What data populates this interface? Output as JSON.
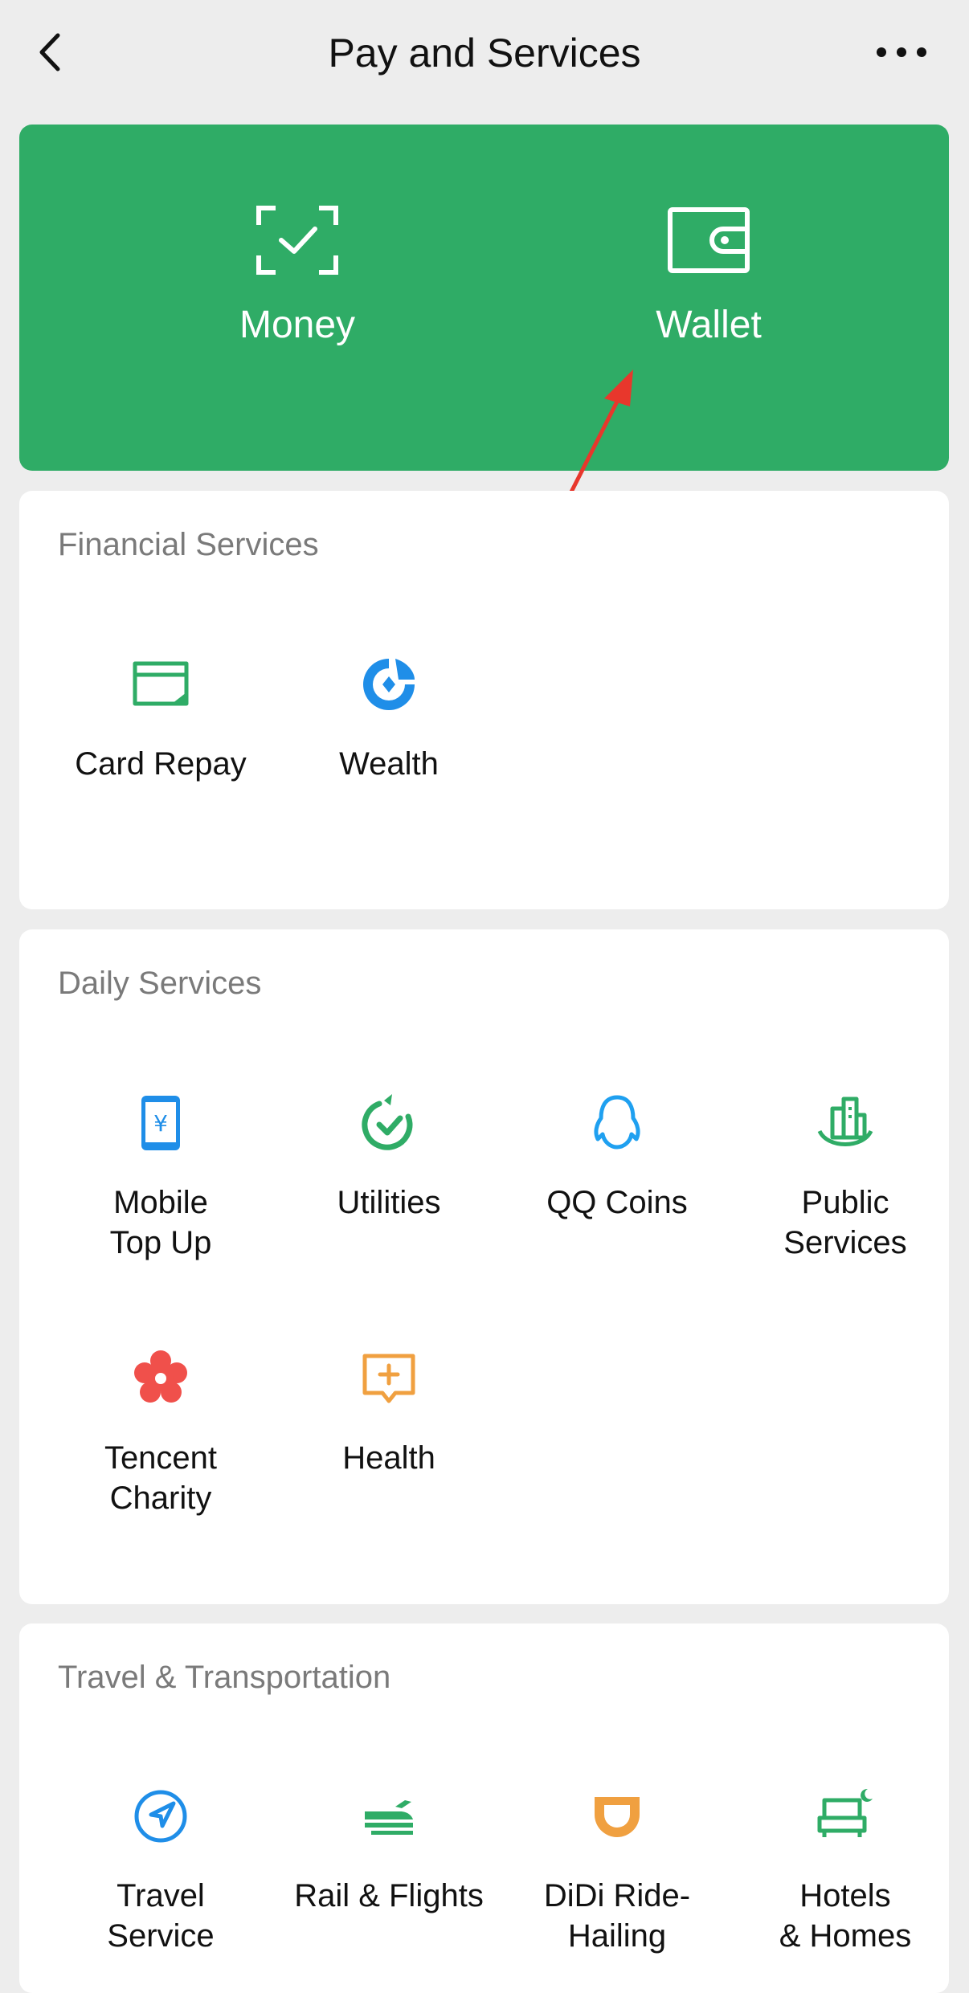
{
  "nav": {
    "title": "Pay and Services"
  },
  "hero": {
    "money_label": "Money",
    "wallet_label": "Wallet"
  },
  "financial": {
    "title": "Financial Services",
    "items": [
      {
        "label": "Card Repay",
        "icon": "card-icon"
      },
      {
        "label": "Wealth",
        "icon": "wealth-icon"
      }
    ]
  },
  "daily": {
    "title": "Daily Services",
    "items": [
      {
        "label": "Mobile\nTop Up",
        "icon": "phone-yuan-icon"
      },
      {
        "label": "Utilities",
        "icon": "utilities-icon"
      },
      {
        "label": "QQ Coins",
        "icon": "qq-penguin-icon"
      },
      {
        "label": "Public\nServices",
        "icon": "city-buildings-icon"
      },
      {
        "label": "Tencent\nCharity",
        "icon": "flower-icon"
      },
      {
        "label": "Health",
        "icon": "health-plus-icon"
      }
    ]
  },
  "travel": {
    "title": "Travel & Transportation",
    "items": [
      {
        "label": "Travel\nService",
        "icon": "compass-arrow-icon"
      },
      {
        "label": "Rail & Flights",
        "icon": "train-plane-icon"
      },
      {
        "label": "DiDi Ride-\nHailing",
        "icon": "didi-icon"
      },
      {
        "label": "Hotels\n& Homes",
        "icon": "bed-moon-icon"
      }
    ]
  },
  "colors": {
    "hero_green": "#2fac66",
    "icon_green": "#2fac66",
    "icon_blue": "#1f8ee8",
    "icon_red": "#f0504b",
    "icon_orange": "#f0a040",
    "annotation_red": "#e8372c"
  }
}
